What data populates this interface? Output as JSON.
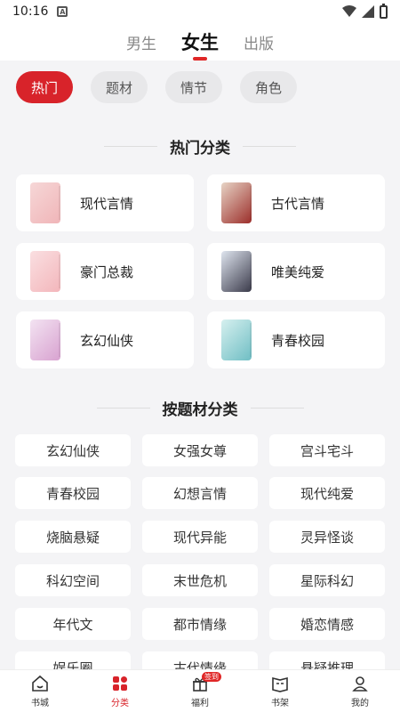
{
  "status": {
    "time": "10:16",
    "notif_icon": "a-notification-icon"
  },
  "top_tabs": [
    "男生",
    "女生",
    "出版"
  ],
  "filters": [
    "热门",
    "题材",
    "情节",
    "角色"
  ],
  "section1": {
    "title": "热门分类"
  },
  "categories": [
    {
      "label": "现代言情",
      "colors": [
        "#f6d7d7",
        "#f0b5b8"
      ]
    },
    {
      "label": "古代言情",
      "colors": [
        "#e7d4c6",
        "#9c2e2a"
      ]
    },
    {
      "label": "豪门总裁",
      "colors": [
        "#fadfe1",
        "#f3b6bb"
      ]
    },
    {
      "label": "唯美纯爱",
      "colors": [
        "#dfe5ef",
        "#3a3a4a"
      ]
    },
    {
      "label": "玄幻仙侠",
      "colors": [
        "#f3e3f2",
        "#d8a2d0"
      ]
    },
    {
      "label": "青春校园",
      "colors": [
        "#d6f0ef",
        "#6fbec4"
      ]
    }
  ],
  "section2": {
    "title": "按题材分类"
  },
  "tags": [
    "玄幻仙侠",
    "女强女尊",
    "宫斗宅斗",
    "青春校园",
    "幻想言情",
    "现代纯爱",
    "烧脑悬疑",
    "现代异能",
    "灵异怪谈",
    "科幻空间",
    "末世危机",
    "星际科幻",
    "年代文",
    "都市情缘",
    "婚恋情感",
    "娱乐圈",
    "古代情缘",
    "悬疑推理"
  ],
  "bottom_nav": [
    {
      "label": "书城",
      "icon": "home-icon"
    },
    {
      "label": "分类",
      "icon": "category-icon"
    },
    {
      "label": "福利",
      "icon": "gift-icon",
      "badge": "签到"
    },
    {
      "label": "书架",
      "icon": "bookshelf-icon"
    },
    {
      "label": "我的",
      "icon": "profile-icon"
    }
  ],
  "colors": {
    "accent": "#d8232a"
  }
}
